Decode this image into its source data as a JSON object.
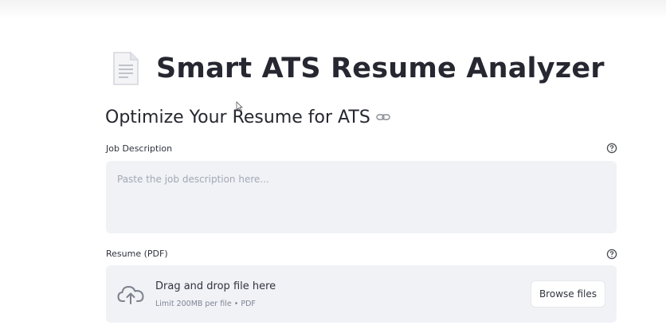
{
  "header": {
    "title": "Smart ATS Resume Analyzer",
    "title_icon": "document-icon"
  },
  "main": {
    "subtitle": "Optimize Your Resume for ATS",
    "subtitle_icon": "link-icon",
    "job_description": {
      "label": "Job Description",
      "placeholder": "Paste the job description here...",
      "value": "",
      "help_icon": "question-circle-icon"
    },
    "resume_upload": {
      "label": "Resume (PDF)",
      "help_icon": "question-circle-icon",
      "upload_icon": "cloud-upload-icon",
      "drop_text": "Drag and drop file here",
      "limit_text": "Limit 200MB per file • PDF",
      "browse_label": "Browse files"
    }
  },
  "colors": {
    "text": "#31333f",
    "title": "#262730",
    "input_bg": "#f0f2f6",
    "muted": "#808495",
    "placeholder": "#a3a8b4"
  }
}
